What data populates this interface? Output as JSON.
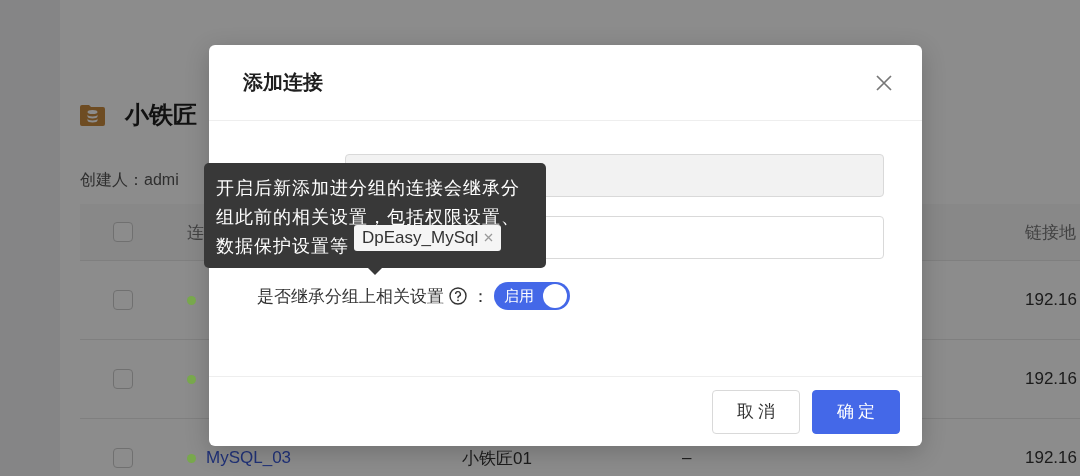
{
  "page": {
    "title": "小铁匠",
    "creator": "创建人：admi",
    "table": {
      "header_checked": false,
      "columns": [
        {
          "label": "连"
        },
        {},
        {},
        {
          "label": "链接地"
        }
      ],
      "rows": [
        {
          "checked": false,
          "color": "#78a84c",
          "address": "192.16"
        },
        {
          "checked": false,
          "color": "#78a84c",
          "address": "192.16"
        },
        {
          "checked": false,
          "color": "#78a84c",
          "name": "MySQL_03",
          "group": "小铁匠01",
          "column_4": "–",
          "address": "192.16"
        }
      ]
    }
  },
  "dialog": {
    "title": "添加连接",
    "fields": [
      {
        "kind": "input",
        "disabled": true
      },
      {
        "kind": "tags",
        "tags": [
          "DpEasy_MySql"
        ]
      },
      {
        "kind": "switch",
        "label": "是否继承分组上相关设置",
        "help": true,
        "colon": "：",
        "on": true,
        "on_text": "启用"
      }
    ],
    "tooltip": "开启后新添加进分组的连接会继承分组此前的相关设置，包括权限设置、数据保护设置等",
    "buttons": [
      {
        "kind": "default",
        "label": "取 消"
      },
      {
        "kind": "primary",
        "label": "确 定"
      }
    ]
  }
}
